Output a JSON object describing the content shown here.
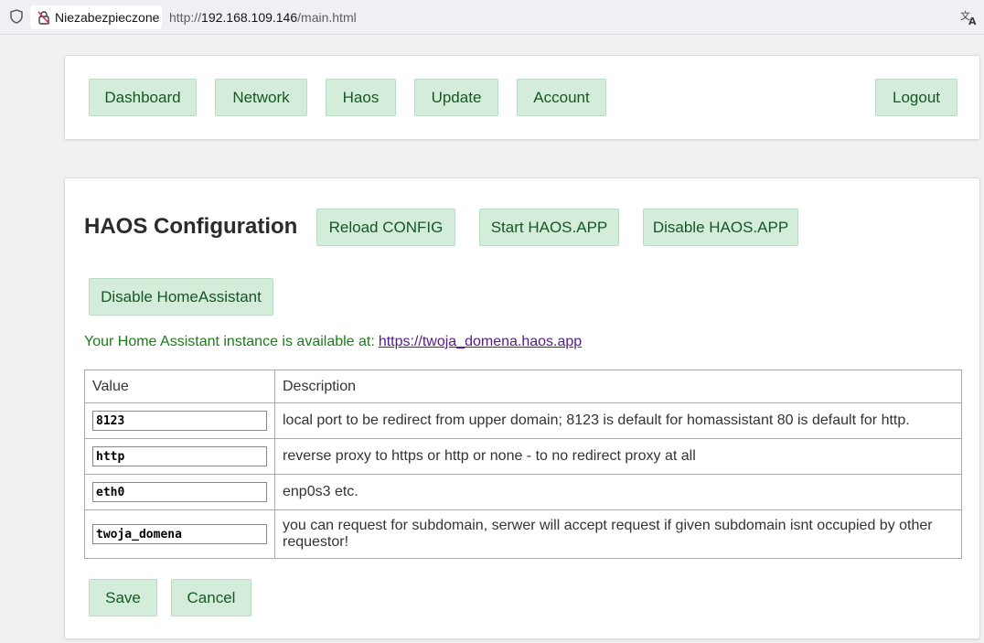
{
  "browser": {
    "security_label": "Niezabezpieczone",
    "url_prefix": "http://",
    "url_host": "192.168.109.146",
    "url_path": "/main.html"
  },
  "nav": {
    "items": [
      "Dashboard",
      "Network",
      "Haos",
      "Update",
      "Account"
    ],
    "logout": "Logout"
  },
  "main": {
    "title": "HAOS Configuration",
    "actions": {
      "reload": "Reload CONFIG",
      "start": "Start HAOS.APP",
      "disable_app": "Disable HAOS.APP",
      "disable_ha": "Disable HomeAssistant"
    },
    "availability_text": "Your Home Assistant instance is available at:",
    "availability_link": "https://twoja_domena.haos.app",
    "table": {
      "headers": [
        "Value",
        "Description"
      ],
      "rows": [
        {
          "value": "8123",
          "description": "local port to be redirect from upper domain; 8123 is default for homassistant 80 is default for http."
        },
        {
          "value": "http",
          "description": "reverse proxy to https or http or none - to no redirect proxy at all"
        },
        {
          "value": "eth0",
          "description": "enp0s3 etc."
        },
        {
          "value": "twoja_domena",
          "description": "you can request for subdomain, serwer will accept request if given subdomain isnt occupied by other requestor!"
        }
      ]
    },
    "save": "Save",
    "cancel": "Cancel"
  },
  "colors": {
    "button_bg": "#d4edda",
    "button_text": "#155724",
    "available_text": "#1a7d1a",
    "link": "#551a8b"
  }
}
